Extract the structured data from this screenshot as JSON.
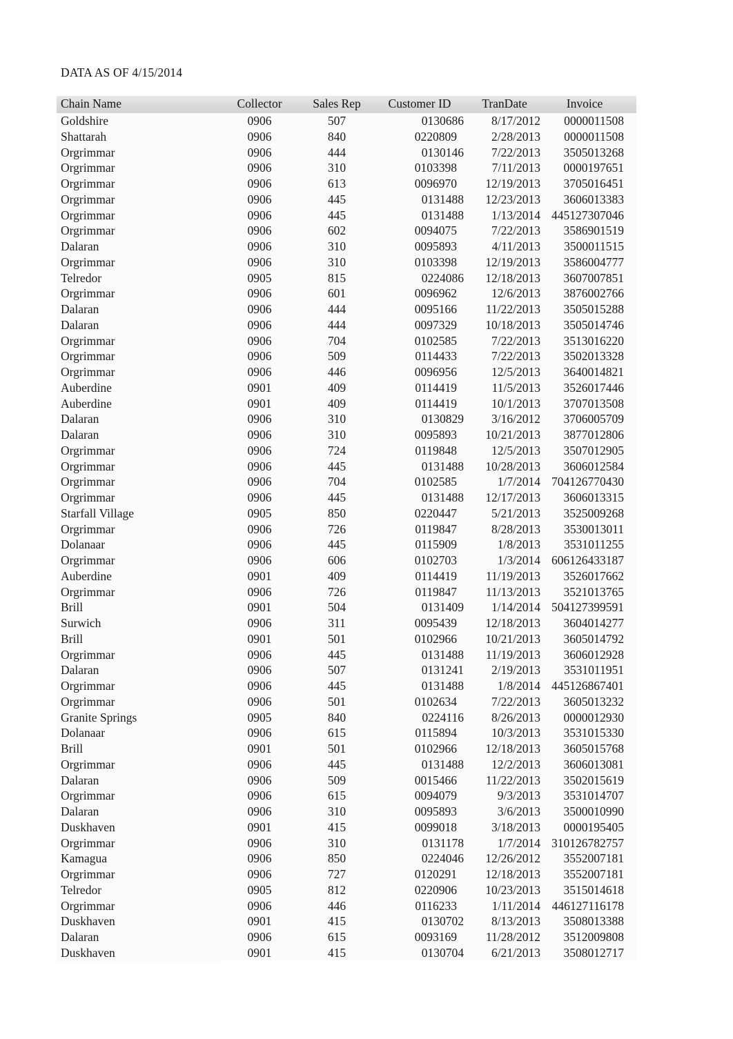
{
  "document": {
    "title": "DATA AS OF 4/15/2014"
  },
  "table": {
    "columns": [
      "Chain Name",
      "Collector",
      "Sales Rep",
      "Customer ID",
      "TranDate",
      "Invoice"
    ],
    "rows": [
      {
        "chain": "Goldshire",
        "collector": "0906",
        "sales_rep": "507",
        "customer_id": "0130686",
        "cust_shift": true,
        "trandate": "8/17/2012",
        "invoice": "0000011508"
      },
      {
        "chain": "Shattarah",
        "collector": "0906",
        "sales_rep": "840",
        "customer_id": "0220809",
        "cust_shift": false,
        "trandate": "2/28/2013",
        "invoice": "0000011508"
      },
      {
        "chain": "Orgrimmar",
        "collector": "0906",
        "sales_rep": "444",
        "customer_id": "0130146",
        "cust_shift": true,
        "trandate": "7/22/2013",
        "invoice": "3505013268"
      },
      {
        "chain": "Orgrimmar",
        "collector": "0906",
        "sales_rep": "310",
        "customer_id": "0103398",
        "cust_shift": false,
        "trandate": "7/11/2013",
        "invoice": "0000197651"
      },
      {
        "chain": "Orgrimmar",
        "collector": "0906",
        "sales_rep": "613",
        "customer_id": "0096970",
        "cust_shift": false,
        "trandate": "12/19/2013",
        "invoice": "3705016451"
      },
      {
        "chain": "Orgrimmar",
        "collector": "0906",
        "sales_rep": "445",
        "customer_id": "0131488",
        "cust_shift": true,
        "trandate": "12/23/2013",
        "invoice": "3606013383"
      },
      {
        "chain": "Orgrimmar",
        "collector": "0906",
        "sales_rep": "445",
        "customer_id": "0131488",
        "cust_shift": true,
        "trandate": "1/13/2014",
        "invoice": "445127307046"
      },
      {
        "chain": "Orgrimmar",
        "collector": "0906",
        "sales_rep": "602",
        "customer_id": "0094075",
        "cust_shift": false,
        "trandate": "7/22/2013",
        "invoice": "3586901519"
      },
      {
        "chain": "Dalaran",
        "collector": "0906",
        "sales_rep": "310",
        "customer_id": "0095893",
        "cust_shift": false,
        "trandate": "4/11/2013",
        "invoice": "3500011515"
      },
      {
        "chain": "Orgrimmar",
        "collector": "0906",
        "sales_rep": "310",
        "customer_id": "0103398",
        "cust_shift": false,
        "trandate": "12/19/2013",
        "invoice": "3586004777"
      },
      {
        "chain": "Telredor",
        "collector": "0905",
        "sales_rep": "815",
        "customer_id": "0224086",
        "cust_shift": true,
        "trandate": "12/18/2013",
        "invoice": "3607007851"
      },
      {
        "chain": "Orgrimmar",
        "collector": "0906",
        "sales_rep": "601",
        "customer_id": "0096962",
        "cust_shift": false,
        "trandate": "12/6/2013",
        "invoice": "3876002766"
      },
      {
        "chain": "Dalaran",
        "collector": "0906",
        "sales_rep": "444",
        "customer_id": "0095166",
        "cust_shift": false,
        "trandate": "11/22/2013",
        "invoice": "3505015288"
      },
      {
        "chain": "Dalaran",
        "collector": "0906",
        "sales_rep": "444",
        "customer_id": "0097329",
        "cust_shift": false,
        "trandate": "10/18/2013",
        "invoice": "3505014746"
      },
      {
        "chain": "Orgrimmar",
        "collector": "0906",
        "sales_rep": "704",
        "customer_id": "0102585",
        "cust_shift": false,
        "trandate": "7/22/2013",
        "invoice": "3513016220"
      },
      {
        "chain": "Orgrimmar",
        "collector": "0906",
        "sales_rep": "509",
        "customer_id": "0114433",
        "cust_shift": false,
        "trandate": "7/22/2013",
        "invoice": "3502013328"
      },
      {
        "chain": "Orgrimmar",
        "collector": "0906",
        "sales_rep": "446",
        "customer_id": "0096956",
        "cust_shift": false,
        "trandate": "12/5/2013",
        "invoice": "3640014821"
      },
      {
        "chain": "Auberdine",
        "collector": "0901",
        "sales_rep": "409",
        "customer_id": "0114419",
        "cust_shift": false,
        "trandate": "11/5/2013",
        "invoice": "3526017446"
      },
      {
        "chain": "Auberdine",
        "collector": "0901",
        "sales_rep": "409",
        "customer_id": "0114419",
        "cust_shift": false,
        "trandate": "10/1/2013",
        "invoice": "3707013508"
      },
      {
        "chain": "Dalaran",
        "collector": "0906",
        "sales_rep": "310",
        "customer_id": "0130829",
        "cust_shift": true,
        "trandate": "3/16/2012",
        "invoice": "3706005709"
      },
      {
        "chain": "Dalaran",
        "collector": "0906",
        "sales_rep": "310",
        "customer_id": "0095893",
        "cust_shift": false,
        "trandate": "10/21/2013",
        "invoice": "3877012806"
      },
      {
        "chain": "Orgrimmar",
        "collector": "0906",
        "sales_rep": "724",
        "customer_id": "0119848",
        "cust_shift": false,
        "trandate": "12/5/2013",
        "invoice": "3507012905"
      },
      {
        "chain": "Orgrimmar",
        "collector": "0906",
        "sales_rep": "445",
        "customer_id": "0131488",
        "cust_shift": true,
        "trandate": "10/28/2013",
        "invoice": "3606012584"
      },
      {
        "chain": "Orgrimmar",
        "collector": "0906",
        "sales_rep": "704",
        "customer_id": "0102585",
        "cust_shift": false,
        "trandate": "1/7/2014",
        "invoice": "704126770430"
      },
      {
        "chain": "Orgrimmar",
        "collector": "0906",
        "sales_rep": "445",
        "customer_id": "0131488",
        "cust_shift": true,
        "trandate": "12/17/2013",
        "invoice": "3606013315"
      },
      {
        "chain": "Starfall Village",
        "collector": "0905",
        "sales_rep": "850",
        "customer_id": "0220447",
        "cust_shift": false,
        "trandate": "5/21/2013",
        "invoice": "3525009268"
      },
      {
        "chain": "Orgrimmar",
        "collector": "0906",
        "sales_rep": "726",
        "customer_id": "0119847",
        "cust_shift": false,
        "trandate": "8/28/2013",
        "invoice": "3530013011"
      },
      {
        "chain": "Dolanaar",
        "collector": "0906",
        "sales_rep": "445",
        "customer_id": "0115909",
        "cust_shift": false,
        "trandate": "1/8/2013",
        "invoice": "3531011255"
      },
      {
        "chain": "Orgrimmar",
        "collector": "0906",
        "sales_rep": "606",
        "customer_id": "0102703",
        "cust_shift": false,
        "trandate": "1/3/2014",
        "invoice": "606126433187"
      },
      {
        "chain": "Auberdine",
        "collector": "0901",
        "sales_rep": "409",
        "customer_id": "0114419",
        "cust_shift": false,
        "trandate": "11/19/2013",
        "invoice": "3526017662"
      },
      {
        "chain": "Orgrimmar",
        "collector": "0906",
        "sales_rep": "726",
        "customer_id": "0119847",
        "cust_shift": false,
        "trandate": "11/13/2013",
        "invoice": "3521013765"
      },
      {
        "chain": "Brill",
        "collector": "0901",
        "sales_rep": "504",
        "customer_id": "0131409",
        "cust_shift": true,
        "trandate": "1/14/2014",
        "invoice": "504127399591"
      },
      {
        "chain": "Surwich",
        "collector": "0906",
        "sales_rep": "311",
        "customer_id": "0095439",
        "cust_shift": false,
        "trandate": "12/18/2013",
        "invoice": "3604014277"
      },
      {
        "chain": "Brill",
        "collector": "0901",
        "sales_rep": "501",
        "customer_id": "0102966",
        "cust_shift": false,
        "trandate": "10/21/2013",
        "invoice": "3605014792"
      },
      {
        "chain": "Orgrimmar",
        "collector": "0906",
        "sales_rep": "445",
        "customer_id": "0131488",
        "cust_shift": true,
        "trandate": "11/19/2013",
        "invoice": "3606012928"
      },
      {
        "chain": "Dalaran",
        "collector": "0906",
        "sales_rep": "507",
        "customer_id": "0131241",
        "cust_shift": true,
        "trandate": "2/19/2013",
        "invoice": "3531011951"
      },
      {
        "chain": "Orgrimmar",
        "collector": "0906",
        "sales_rep": "445",
        "customer_id": "0131488",
        "cust_shift": true,
        "trandate": "1/8/2014",
        "invoice": "445126867401"
      },
      {
        "chain": "Orgrimmar",
        "collector": "0906",
        "sales_rep": "501",
        "customer_id": "0102634",
        "cust_shift": false,
        "trandate": "7/22/2013",
        "invoice": "3605013232"
      },
      {
        "chain": "Granite Springs",
        "collector": "0905",
        "sales_rep": "840",
        "customer_id": "0224116",
        "cust_shift": true,
        "trandate": "8/26/2013",
        "invoice": "0000012930"
      },
      {
        "chain": "Dolanaar",
        "collector": "0906",
        "sales_rep": "615",
        "customer_id": "0115894",
        "cust_shift": false,
        "trandate": "10/3/2013",
        "invoice": "3531015330"
      },
      {
        "chain": "Brill",
        "collector": "0901",
        "sales_rep": "501",
        "customer_id": "0102966",
        "cust_shift": false,
        "trandate": "12/18/2013",
        "invoice": "3605015768"
      },
      {
        "chain": "Orgrimmar",
        "collector": "0906",
        "sales_rep": "445",
        "customer_id": "0131488",
        "cust_shift": true,
        "trandate": "12/2/2013",
        "invoice": "3606013081"
      },
      {
        "chain": "Dalaran",
        "collector": "0906",
        "sales_rep": "509",
        "customer_id": "0015466",
        "cust_shift": false,
        "trandate": "11/22/2013",
        "invoice": "3502015619"
      },
      {
        "chain": "Orgrimmar",
        "collector": "0906",
        "sales_rep": "615",
        "customer_id": "0094079",
        "cust_shift": false,
        "trandate": "9/3/2013",
        "invoice": "3531014707"
      },
      {
        "chain": "Dalaran",
        "collector": "0906",
        "sales_rep": "310",
        "customer_id": "0095893",
        "cust_shift": false,
        "trandate": "3/6/2013",
        "invoice": "3500010990"
      },
      {
        "chain": "Duskhaven",
        "collector": "0901",
        "sales_rep": "415",
        "customer_id": "0099018",
        "cust_shift": false,
        "trandate": "3/18/2013",
        "invoice": "0000195405"
      },
      {
        "chain": "Orgrimmar",
        "collector": "0906",
        "sales_rep": "310",
        "customer_id": "0131178",
        "cust_shift": true,
        "trandate": "1/7/2014",
        "invoice": "310126782757"
      },
      {
        "chain": "Kamagua",
        "collector": "0906",
        "sales_rep": "850",
        "customer_id": "0224046",
        "cust_shift": true,
        "trandate": "12/26/2012",
        "invoice": "3552007181"
      },
      {
        "chain": "Orgrimmar",
        "collector": "0906",
        "sales_rep": "727",
        "customer_id": "0120291",
        "cust_shift": false,
        "trandate": "12/18/2013",
        "invoice": "3552007181"
      },
      {
        "chain": "Telredor",
        "collector": "0905",
        "sales_rep": "812",
        "customer_id": "0220906",
        "cust_shift": false,
        "trandate": "10/23/2013",
        "invoice": "3515014618"
      },
      {
        "chain": "Orgrimmar",
        "collector": "0906",
        "sales_rep": "446",
        "customer_id": "0116233",
        "cust_shift": false,
        "trandate": "1/11/2014",
        "invoice": "446127116178"
      },
      {
        "chain": "Duskhaven",
        "collector": "0901",
        "sales_rep": "415",
        "customer_id": "0130702",
        "cust_shift": true,
        "trandate": "8/13/2013",
        "invoice": "3508013388"
      },
      {
        "chain": "Dalaran",
        "collector": "0906",
        "sales_rep": "615",
        "customer_id": "0093169",
        "cust_shift": false,
        "trandate": "11/28/2012",
        "invoice": "3512009808"
      },
      {
        "chain": "Duskhaven",
        "collector": "0901",
        "sales_rep": "415",
        "customer_id": "0130704",
        "cust_shift": true,
        "trandate": "6/21/2013",
        "invoice": "3508012717"
      }
    ]
  }
}
